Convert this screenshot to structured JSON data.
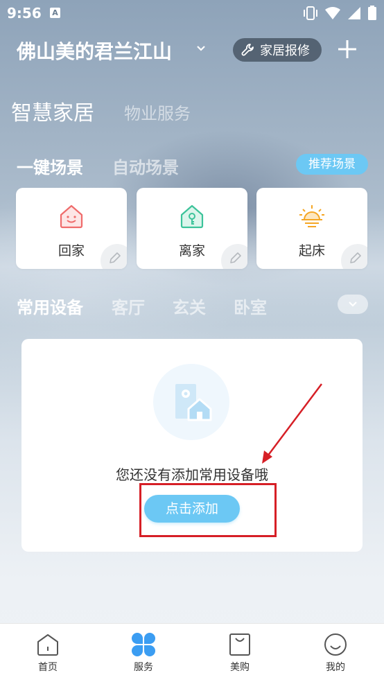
{
  "status_bar": {
    "time": "9:56",
    "badge": "A"
  },
  "header": {
    "home_name": "佛山美的君兰江山",
    "repair_label": "家居报修"
  },
  "main_tabs": [
    {
      "label": "智慧家居",
      "active": true
    },
    {
      "label": "物业服务",
      "active": false
    }
  ],
  "scenes": {
    "tabs": [
      {
        "label": "一键场景",
        "active": true
      },
      {
        "label": "自动场景",
        "active": false
      }
    ],
    "recommend_label": "推荐场景",
    "cards": [
      {
        "label": "回家",
        "icon": "house-smile-icon",
        "color": "#ef6b6b"
      },
      {
        "label": "离家",
        "icon": "house-key-icon",
        "color": "#3cc39a"
      },
      {
        "label": "起床",
        "icon": "sunrise-icon",
        "color": "#f5a623"
      }
    ]
  },
  "devices": {
    "tabs": [
      {
        "label": "常用设备",
        "active": true
      },
      {
        "label": "客厅",
        "active": false
      },
      {
        "label": "玄关",
        "active": false
      },
      {
        "label": "卧室",
        "active": false
      }
    ],
    "empty_text": "您还没有添加常用设备哦",
    "add_label": "点击添加"
  },
  "bottom_nav": [
    {
      "label": "首页",
      "icon": "home-icon"
    },
    {
      "label": "服务",
      "icon": "service-grid-icon",
      "active": true
    },
    {
      "label": "美购",
      "icon": "shopping-bag-icon"
    },
    {
      "label": "我的",
      "icon": "smiley-profile-icon"
    }
  ],
  "colors": {
    "accent": "#6cc8f4",
    "annotation": "#d61f26"
  }
}
